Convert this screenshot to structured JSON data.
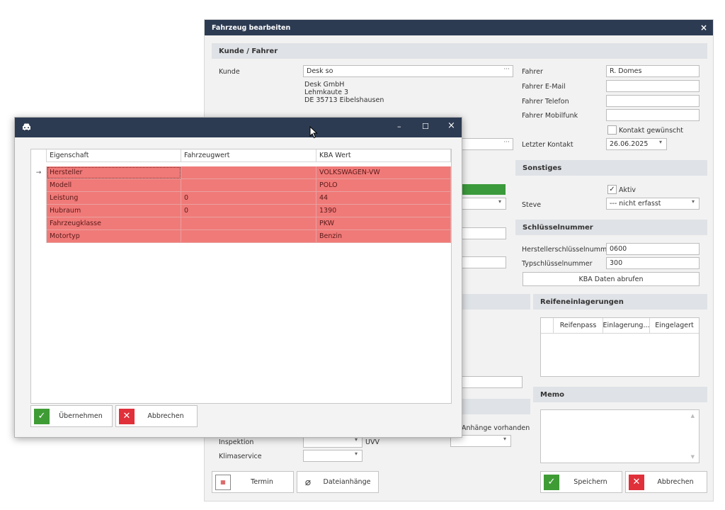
{
  "bg": {
    "title": "Fahrzeug bearbeiten",
    "close": "×",
    "section_kunde": "Kunde / Fahrer",
    "kunde_label": "Kunde",
    "kunde_value": "Desk so",
    "address": [
      "Desk GmbH",
      "Lehmkaute 3",
      "DE 35713 Eibelshausen"
    ],
    "fahrer_label": "Fahrer",
    "fahrer_value": "R. Domes",
    "email_label": "Fahrer E-Mail",
    "telefon_label": "Fahrer Telefon",
    "mobil_label": "Fahrer Mobilfunk",
    "kontakt_gewuenscht": "Kontakt gewünscht",
    "letzter_kontakt_label": "Letzter Kontakt",
    "letzter_kontakt_value": "26.06.2025",
    "section_sonstiges": "Sonstiges",
    "aktiv_label": "Aktiv",
    "steve_label": "Steve",
    "steve_value": "--- nicht erfasst",
    "section_schluessel": "Schlüsselnummer",
    "hsn_label": "Herstellerschlüsselnummer",
    "hsn_value": "0600",
    "tsn_label": "Typschlüsselnummer",
    "tsn_value": "300",
    "kba_button": "KBA Daten abrufen",
    "section_reifen": "Reifeneinlagerungen",
    "reifen_cols": [
      "Reifenpass",
      "Einlagerung...",
      "Eingelagert"
    ],
    "section_memo": "Memo",
    "anhaenge": "Anhänge vorhanden",
    "inspektion_label": "Inspektion",
    "klimaservice_label": "Klimaservice",
    "uvv_label": "UVV",
    "termin_button": "Termin",
    "dateianhaenge_button": "Dateianhänge",
    "speichern_button": "Speichern",
    "abbrechen_button": "Abbrechen"
  },
  "dialog": {
    "minimize": "–",
    "maximize": "☐",
    "close": "×",
    "columns": [
      "Eigenschaft",
      "Fahrzeugwert",
      "KBA Wert"
    ],
    "rows": [
      {
        "eigenschaft": "Hersteller",
        "fahrzeugwert": "",
        "kba": "VOLKSWAGEN-VW"
      },
      {
        "eigenschaft": "Modell",
        "fahrzeugwert": "",
        "kba": "POLO"
      },
      {
        "eigenschaft": "Leistung",
        "fahrzeugwert": "0",
        "kba": "44"
      },
      {
        "eigenschaft": "Hubraum",
        "fahrzeugwert": "0",
        "kba": "1390"
      },
      {
        "eigenschaft": "Fahrzeugklasse",
        "fahrzeugwert": "",
        "kba": "PKW"
      },
      {
        "eigenschaft": "Motortyp",
        "fahrzeugwert": "",
        "kba": "Benzin"
      }
    ],
    "uebernehmen_button": "Übernehmen",
    "abbrechen_button": "Abbrechen"
  },
  "colors": {
    "titlebar": "#2d3b52",
    "row_red": "#f07a78",
    "ok_green": "#3f9c35",
    "cancel_red": "#e0303a"
  }
}
